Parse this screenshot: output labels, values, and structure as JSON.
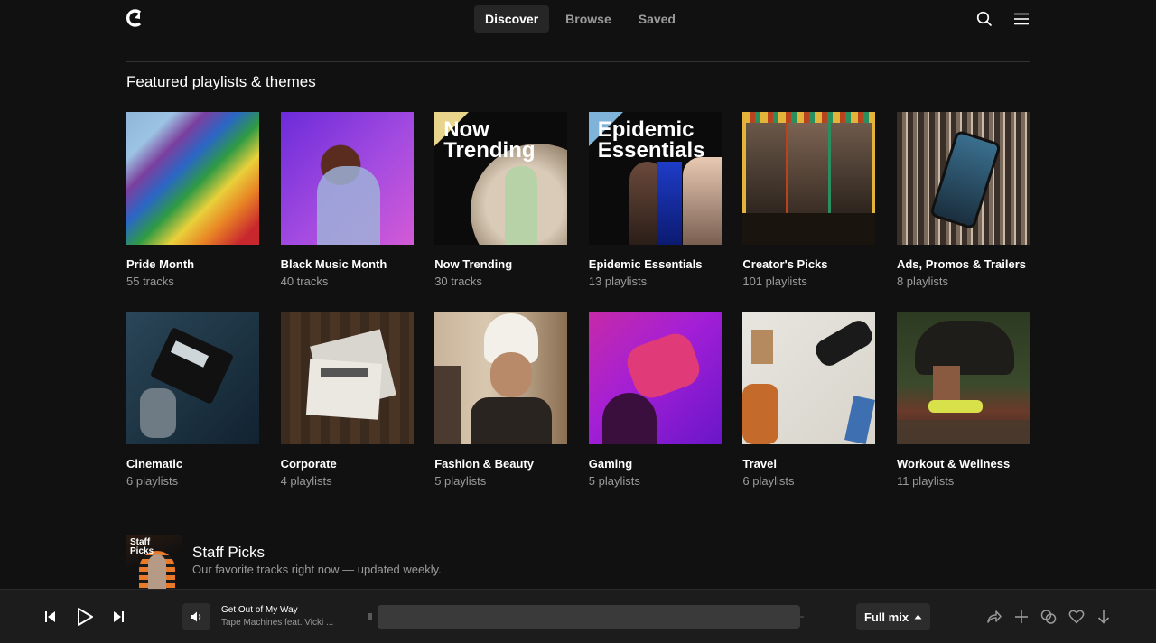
{
  "header": {
    "logo": "logo-icon",
    "tabs": [
      {
        "label": "Discover",
        "active": true
      },
      {
        "label": "Browse",
        "active": false
      },
      {
        "label": "Saved",
        "active": false
      }
    ],
    "icons": [
      "search-icon",
      "menu-icon"
    ]
  },
  "section": {
    "title": "Featured playlists & themes"
  },
  "playlists": [
    {
      "title": "Pride Month",
      "sub": "55 tracks",
      "cover_text": ""
    },
    {
      "title": "Black Music Month",
      "sub": "40 tracks",
      "cover_text": ""
    },
    {
      "title": "Now Trending",
      "sub": "30 tracks",
      "cover_text": "Now Trending"
    },
    {
      "title": "Epidemic Essentials",
      "sub": "13 playlists",
      "cover_text": "Epidemic Essentials"
    },
    {
      "title": "Creator's Picks",
      "sub": "101 playlists",
      "cover_text": ""
    },
    {
      "title": "Ads, Promos & Trailers",
      "sub": "8 playlists",
      "cover_text": ""
    },
    {
      "title": "Cinematic",
      "sub": "6 playlists",
      "cover_text": ""
    },
    {
      "title": "Corporate",
      "sub": "4 playlists",
      "cover_text": ""
    },
    {
      "title": "Fashion & Beauty",
      "sub": "5 playlists",
      "cover_text": ""
    },
    {
      "title": "Gaming",
      "sub": "5 playlists",
      "cover_text": ""
    },
    {
      "title": "Travel",
      "sub": "6 playlists",
      "cover_text": ""
    },
    {
      "title": "Workout & Wellness",
      "sub": "11 playlists",
      "cover_text": ""
    }
  ],
  "staff_picks": {
    "cover_text": "Staff Picks",
    "title": "Staff Picks",
    "description": "Our favorite tracks right now — updated weekly."
  },
  "player": {
    "track_title": "Get Out of My Way",
    "track_artist": "Tape Machines feat. Vicki ...",
    "mix_label": "Full mix",
    "icons": [
      "previous-icon",
      "play-icon",
      "next-icon",
      "volume-icon",
      "share-icon",
      "add-icon",
      "similar-icon",
      "heart-icon",
      "download-icon"
    ]
  },
  "colors": {
    "background": "#111111",
    "player": "#1c1c1c",
    "muted": "#9a9a9a",
    "active_tab": "#262626"
  }
}
